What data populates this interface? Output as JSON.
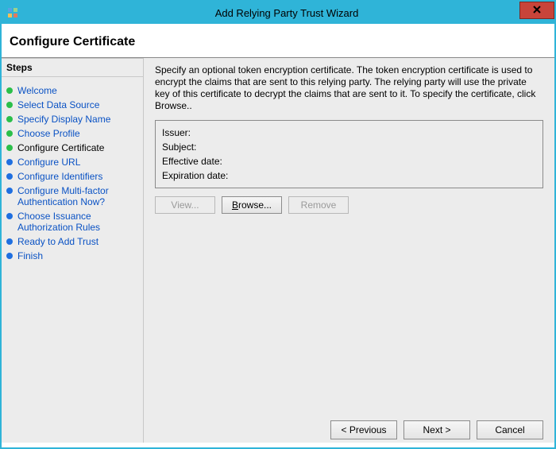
{
  "window": {
    "title": "Add Relying Party Trust Wizard"
  },
  "header": {
    "title": "Configure Certificate"
  },
  "sidebar": {
    "header": "Steps",
    "items": [
      {
        "label": "Welcome",
        "state": "done"
      },
      {
        "label": "Select Data Source",
        "state": "done"
      },
      {
        "label": "Specify Display Name",
        "state": "done"
      },
      {
        "label": "Choose Profile",
        "state": "done"
      },
      {
        "label": "Configure Certificate",
        "state": "current"
      },
      {
        "label": "Configure URL",
        "state": "pending"
      },
      {
        "label": "Configure Identifiers",
        "state": "pending"
      },
      {
        "label": "Configure Multi-factor Authentication Now?",
        "state": "pending"
      },
      {
        "label": "Choose Issuance Authorization Rules",
        "state": "pending"
      },
      {
        "label": "Ready to Add Trust",
        "state": "pending"
      },
      {
        "label": "Finish",
        "state": "pending"
      }
    ]
  },
  "content": {
    "description": "Specify an optional token encryption certificate.  The token encryption certificate is used to encrypt the claims that are sent to this relying party.  The relying party will use the private key of this certificate to decrypt the claims that are sent to it.  To specify the certificate, click Browse..",
    "cert": {
      "issuer_label": "Issuer:",
      "issuer_value": "",
      "subject_label": "Subject:",
      "subject_value": "",
      "effective_label": "Effective date:",
      "effective_value": "",
      "expiration_label": "Expiration date:",
      "expiration_value": ""
    },
    "buttons": {
      "view": "View...",
      "browse_prefix": "B",
      "browse_rest": "rowse...",
      "remove": "Remove"
    }
  },
  "footer": {
    "previous": "< Previous",
    "next": "Next >",
    "cancel": "Cancel"
  }
}
